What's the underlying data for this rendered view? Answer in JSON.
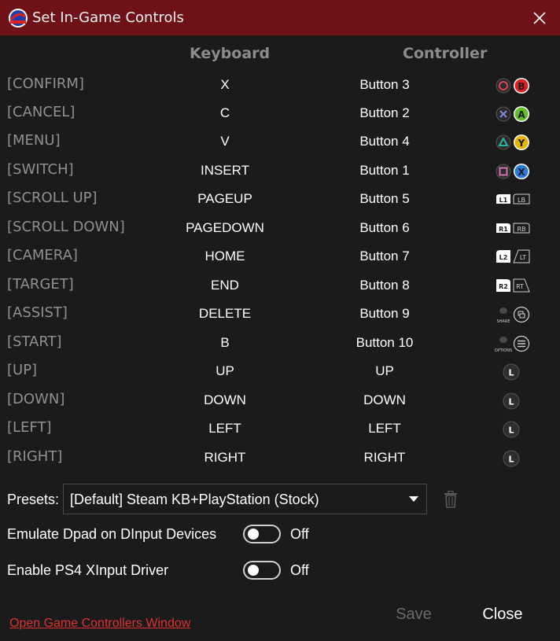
{
  "window": {
    "title": "Set In-Game Controls"
  },
  "columns": {
    "keyboard": "Keyboard",
    "controller": "Controller"
  },
  "rows": [
    {
      "action": "[CONFIRM]",
      "keyboard": "X",
      "controller": "Button 3"
    },
    {
      "action": "[CANCEL]",
      "keyboard": "C",
      "controller": "Button 2"
    },
    {
      "action": "[MENU]",
      "keyboard": "V",
      "controller": "Button 4"
    },
    {
      "action": "[SWITCH]",
      "keyboard": "INSERT",
      "controller": "Button 1"
    },
    {
      "action": "[SCROLL UP]",
      "keyboard": "PAGEUP",
      "controller": "Button 5"
    },
    {
      "action": "[SCROLL DOWN]",
      "keyboard": "PAGEDOWN",
      "controller": "Button 6"
    },
    {
      "action": "[CAMERA]",
      "keyboard": "HOME",
      "controller": "Button 7"
    },
    {
      "action": "[TARGET]",
      "keyboard": "END",
      "controller": "Button 8"
    },
    {
      "action": "[ASSIST]",
      "keyboard": "DELETE",
      "controller": "Button 9"
    },
    {
      "action": "[START]",
      "keyboard": "B",
      "controller": "Button 10"
    },
    {
      "action": "[UP]",
      "keyboard": "UP",
      "controller": "UP"
    },
    {
      "action": "[DOWN]",
      "keyboard": "DOWN",
      "controller": "DOWN"
    },
    {
      "action": "[LEFT]",
      "keyboard": "LEFT",
      "controller": "LEFT"
    },
    {
      "action": "[RIGHT]",
      "keyboard": "RIGHT",
      "controller": "RIGHT"
    }
  ],
  "glyph_labels": {
    "xbox_b": "B",
    "xbox_a": "A",
    "xbox_y": "Y",
    "xbox_x": "X",
    "l1": "L1",
    "lb": "LB",
    "r1": "R1",
    "rb": "RB",
    "l2": "L2",
    "lt": "LT",
    "r2": "R2",
    "rt": "RT",
    "share": "SHARE",
    "options": "OPTIONS",
    "lstick": "L"
  },
  "presets": {
    "label": "Presets:",
    "value": "[Default] Steam KB+PlayStation (Stock)"
  },
  "options": [
    {
      "label": "Emulate Dpad on DInput Devices",
      "state": "Off"
    },
    {
      "label": "Enable PS4 XInput Driver",
      "state": "Off"
    }
  ],
  "footer": {
    "link": "Open Game Controllers Window",
    "save": "Save",
    "close": "Close"
  },
  "colors": {
    "titlebar": "#6e1218",
    "background": "#1b1b1b",
    "link": "#e03030",
    "ps_circle": "#e0454f",
    "ps_cross": "#7c8cd8",
    "ps_triangle": "#2fb7a0",
    "ps_square": "#d76fb8",
    "xbox_b": "#e02020",
    "xbox_a": "#5fbf2a",
    "xbox_y": "#e8b400",
    "xbox_x": "#2a7bd8"
  }
}
